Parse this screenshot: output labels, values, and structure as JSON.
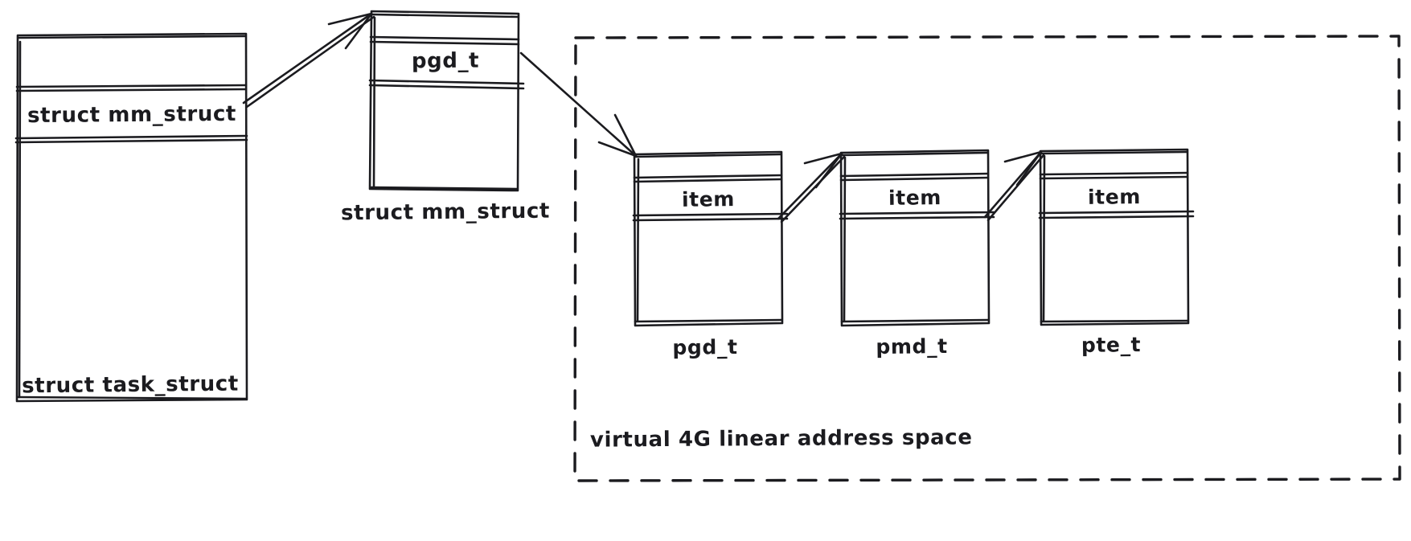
{
  "diagram": {
    "style": "hand-drawn sketch",
    "stroke_color": "#1b1b1f",
    "background_color": "#ffffff",
    "task_struct": {
      "caption": "struct task_struct",
      "row_label": "struct mm_struct"
    },
    "mm_struct": {
      "caption": "struct mm_struct",
      "row_label": "pgd_t"
    },
    "address_space": {
      "caption": "virtual 4G linear address space",
      "border_style": "dashed",
      "boxes": [
        {
          "row_label": "item",
          "caption": "pgd_t"
        },
        {
          "row_label": "item",
          "caption": "pmd_t"
        },
        {
          "row_label": "item",
          "caption": "pte_t"
        }
      ]
    },
    "arrows": [
      {
        "from": "struct mm_struct row",
        "to": "struct mm_struct box"
      },
      {
        "from": "pgd_t row",
        "to": "pgd_t item box"
      },
      {
        "from": "pgd_t item box",
        "to": "pmd_t item box"
      },
      {
        "from": "pmd_t item box",
        "to": "pte_t item box"
      }
    ]
  }
}
